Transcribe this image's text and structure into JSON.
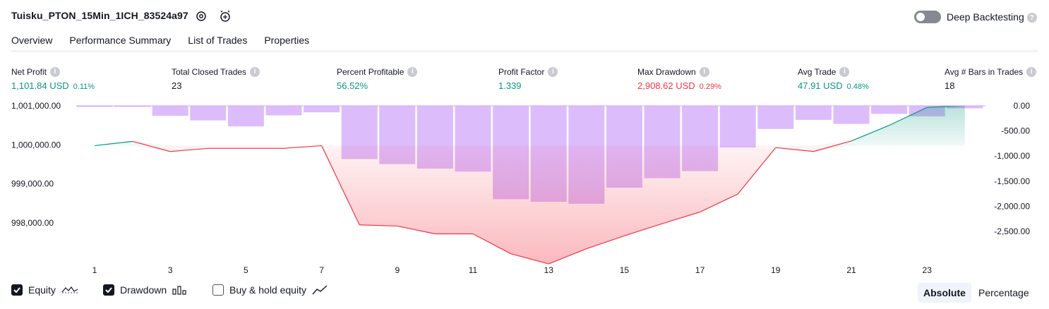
{
  "header": {
    "title": "Tuisku_PTON_15Min_1ICH_83524a97",
    "deep_backtesting_label": "Deep Backtesting"
  },
  "tabs": [
    "Overview",
    "Performance Summary",
    "List of Trades",
    "Properties"
  ],
  "metrics": [
    {
      "label": "Net Profit",
      "value": "1,101.84 USD",
      "pct": "0.11%",
      "color": "green"
    },
    {
      "label": "Total Closed Trades",
      "value": "23",
      "pct": "",
      "color": "default"
    },
    {
      "label": "Percent Profitable",
      "value": "56.52%",
      "pct": "",
      "color": "green"
    },
    {
      "label": "Profit Factor",
      "value": "1.339",
      "pct": "",
      "color": "green"
    },
    {
      "label": "Max Drawdown",
      "value": "2,908.62 USD",
      "pct": "0.29%",
      "color": "red"
    },
    {
      "label": "Avg Trade",
      "value": "47.91 USD",
      "pct": "0.48%",
      "color": "green"
    },
    {
      "label": "Avg # Bars in Trades",
      "value": "18",
      "pct": "",
      "color": "default"
    }
  ],
  "chart_data": {
    "type": "line",
    "left_axis_ticks": [
      "1,001,000.00",
      "1,000,000.00",
      "999,000.00",
      "998,000.00"
    ],
    "left_axis_values": [
      1001000,
      1000000,
      999000,
      998000
    ],
    "right_axis_ticks": [
      "0.00",
      "-500.00",
      "-1,000.00",
      "-1,500.00",
      "-2,000.00",
      "-2,500.00"
    ],
    "right_axis_values": [
      0,
      -500,
      -1000,
      -1500,
      -2000,
      -2500
    ],
    "x_ticks": [
      "1",
      "3",
      "5",
      "7",
      "9",
      "11",
      "13",
      "15",
      "17",
      "19",
      "21",
      "23"
    ],
    "equity": {
      "name": "Equity",
      "x": [
        1,
        2,
        3,
        4,
        5,
        6,
        7,
        8,
        9,
        10,
        11,
        12,
        13,
        14,
        15,
        16,
        17,
        18,
        19,
        20,
        21,
        22,
        23,
        24
      ],
      "values": [
        999980,
        1000090,
        999830,
        999910,
        999910,
        999910,
        999980,
        997950,
        997920,
        997720,
        997720,
        997210,
        996950,
        997340,
        997670,
        997980,
        998280,
        998740,
        999930,
        999830,
        1000100,
        1000500,
        1000960,
        1001000
      ]
    },
    "drawdown": {
      "name": "Drawdown",
      "x": [
        1,
        2,
        3,
        4,
        5,
        6,
        7,
        8,
        9,
        10,
        11,
        12,
        13,
        14,
        15,
        16,
        17,
        18,
        19,
        20,
        21,
        22,
        23,
        24
      ],
      "values": [
        0,
        -20,
        -200,
        -290,
        -410,
        -190,
        -130,
        -1060,
        -1160,
        -1250,
        -1310,
        -1860,
        -1910,
        -1950,
        -1630,
        -1440,
        -1300,
        -830,
        -460,
        -280,
        -360,
        -160,
        -210,
        -50
      ]
    },
    "ylim_left": [
      997000,
      1001000
    ],
    "ylim_right": [
      -2908.62,
      0
    ]
  },
  "bottom": {
    "equity_label": "Equity",
    "drawdown_label": "Drawdown",
    "buyhold_label": "Buy & hold equity",
    "absolute_label": "Absolute",
    "percentage_label": "Percentage"
  },
  "colors": {
    "green": "#089981",
    "red": "#f23645",
    "bar": "#d1a5fb",
    "equity_green": "#089981",
    "equity_red": "#f23645"
  }
}
